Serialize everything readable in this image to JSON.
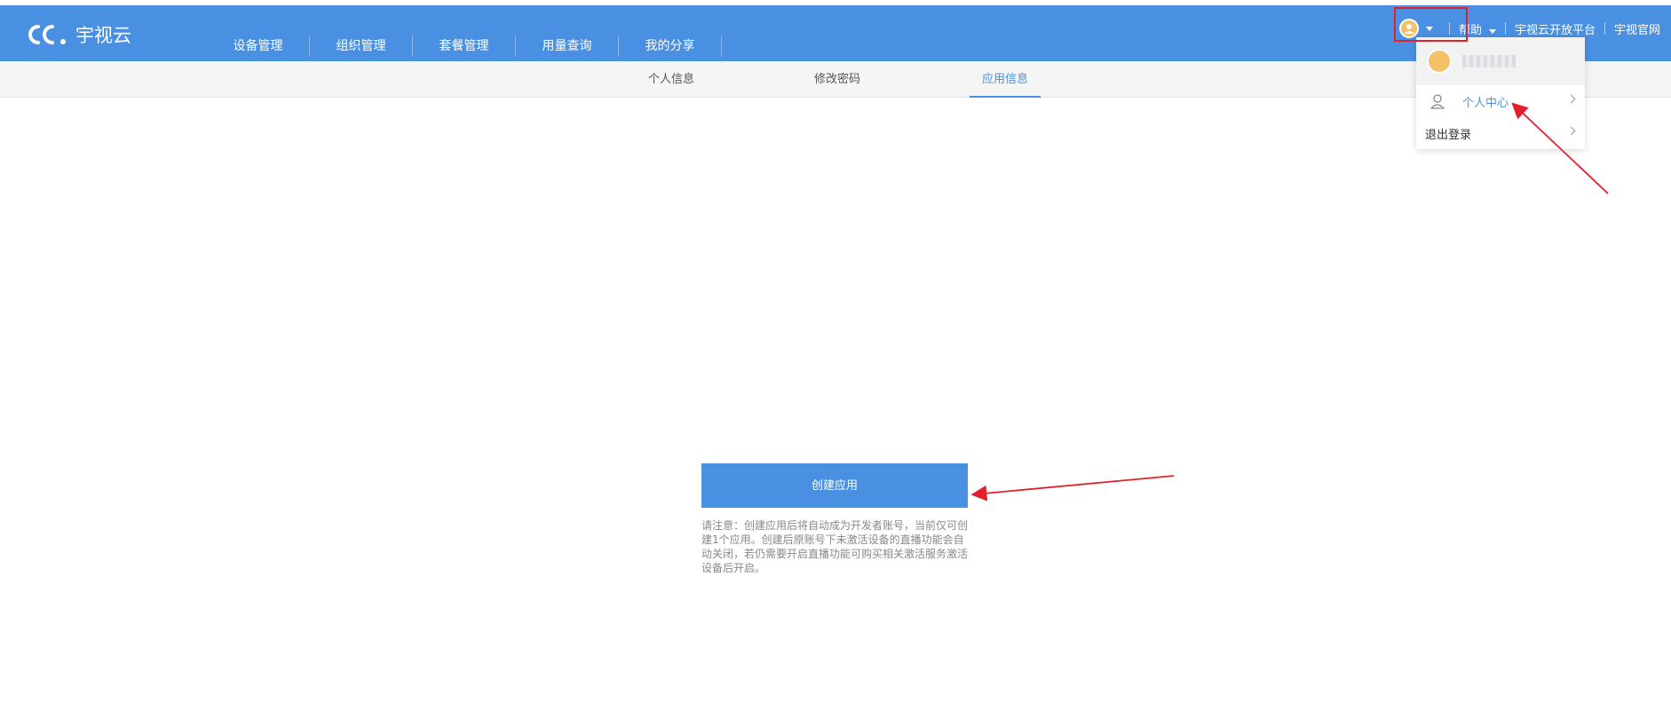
{
  "header": {
    "brand": "宇视云",
    "nav": [
      "设备管理",
      "组织管理",
      "套餐管理",
      "用量查询",
      "我的分享"
    ],
    "help_label": "帮助",
    "open_platform_label": "宇视云开放平台",
    "official_site_label": "宇视官网"
  },
  "subnav": {
    "tabs": [
      "个人信息",
      "修改密码",
      "应用信息"
    ],
    "active_index": 2
  },
  "dropdown": {
    "personal_center_label": "个人中心",
    "logout_label": "退出登录"
  },
  "main": {
    "create_button_label": "创建应用",
    "notice_text": "请注意：创建应用后将自动成为开发者账号，当前仅可创建1个应用。创建后原账号下未激活设备的直播功能会自动关闭，若仍需要开启直播功能可购买相关激活服务激活设备后开启。"
  },
  "colors": {
    "brand_blue": "#4a90e2",
    "annotation_red": "#e0202a"
  }
}
